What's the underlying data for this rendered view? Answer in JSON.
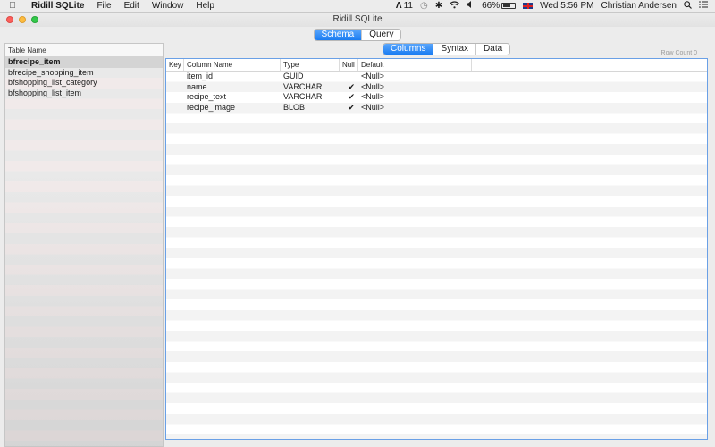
{
  "menubar": {
    "app_name": "Ridill SQLite",
    "menus": [
      "File",
      "Edit",
      "Window",
      "Help"
    ],
    "status": {
      "adobe_count": "11",
      "battery": "66%",
      "battery_level": 0.66,
      "datetime": "Wed 5:56 PM",
      "user": "Christian Andersen"
    }
  },
  "window": {
    "title": "Ridill SQLite",
    "top_tabs": [
      {
        "label": "Schema",
        "active": true
      },
      {
        "label": "Query",
        "active": false
      }
    ]
  },
  "sidebar": {
    "header": "Table Name",
    "tables": [
      {
        "name": "bfrecipe_item",
        "selected": true
      },
      {
        "name": "bfrecipe_shopping_item",
        "selected": false
      },
      {
        "name": "bfshopping_list_category",
        "selected": false
      },
      {
        "name": "bfshopping_list_item",
        "selected": false
      }
    ]
  },
  "detail": {
    "tabs": [
      {
        "label": "Columns",
        "active": true
      },
      {
        "label": "Syntax",
        "active": false
      },
      {
        "label": "Data",
        "active": false
      }
    ],
    "row_count": "Row Count 0",
    "headers": [
      "Key",
      "Column Name",
      "Type",
      "Null",
      "Default"
    ],
    "rows": [
      {
        "key": "",
        "name": "item_id",
        "type": "GUID",
        "null": "",
        "default": "<Null>"
      },
      {
        "key": "",
        "name": "name",
        "type": "VARCHAR",
        "null": "✔",
        "default": "<Null>"
      },
      {
        "key": "",
        "name": "recipe_text",
        "type": "VARCHAR",
        "null": "✔",
        "default": "<Null>"
      },
      {
        "key": "",
        "name": "recipe_image",
        "type": "BLOB",
        "null": "✔",
        "default": "<Null>"
      }
    ]
  }
}
